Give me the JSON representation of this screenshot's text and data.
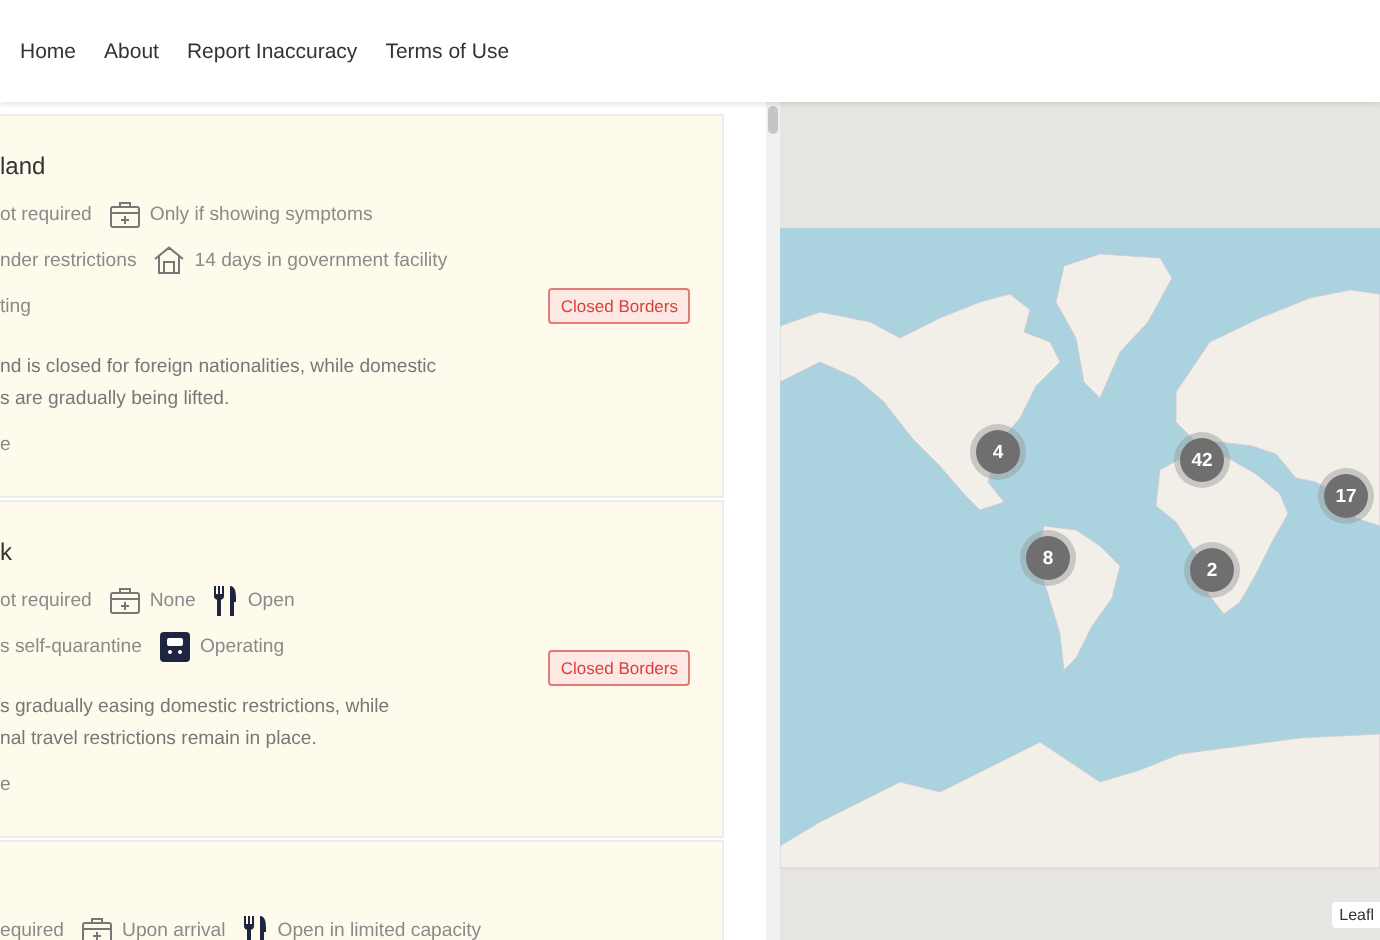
{
  "nav": {
    "links": [
      "Home",
      "About",
      "Report Inaccuracy",
      "Terms of Use"
    ]
  },
  "countries": [
    {
      "name": "land",
      "lines": [
        {
          "items": [
            {
              "text": "ot required"
            },
            {
              "kind": "kit",
              "text": "Only if showing symptoms"
            }
          ]
        },
        {
          "items": [
            {
              "text": "nder restrictions"
            },
            {
              "kind": "house",
              "text": "14 days in government facility"
            }
          ]
        },
        {
          "items": [
            {
              "text": "ting"
            }
          ]
        }
      ],
      "badge": "Closed Borders",
      "description": [
        "nd is closed for foreign nationalities, while domestic",
        "s are gradually being lifted."
      ],
      "link": "e"
    },
    {
      "name": "k",
      "lines": [
        {
          "items": [
            {
              "text": "ot required"
            },
            {
              "kind": "kit",
              "text": "None"
            },
            {
              "kind": "fork",
              "text": "Open"
            }
          ]
        },
        {
          "items": [
            {
              "text": "s self-quarantine"
            },
            {
              "kind": "bus",
              "text": "Operating"
            }
          ]
        }
      ],
      "badge": "Closed Borders",
      "description": [
        "s gradually easing domestic restrictions, while",
        "nal travel restrictions remain in place."
      ],
      "link": "e"
    },
    {
      "lines": [
        {
          "items": [
            {
              "text": "equired"
            },
            {
              "kind": "kit",
              "text": "Upon arrival"
            },
            {
              "kind": "fork",
              "text": "Open in limited capacity"
            }
          ]
        }
      ]
    }
  ],
  "map": {
    "clusters": [
      {
        "count": "4"
      },
      {
        "count": "42"
      },
      {
        "count": "17"
      },
      {
        "count": "8"
      },
      {
        "count": "2"
      }
    ],
    "attribution": "Leafl"
  }
}
